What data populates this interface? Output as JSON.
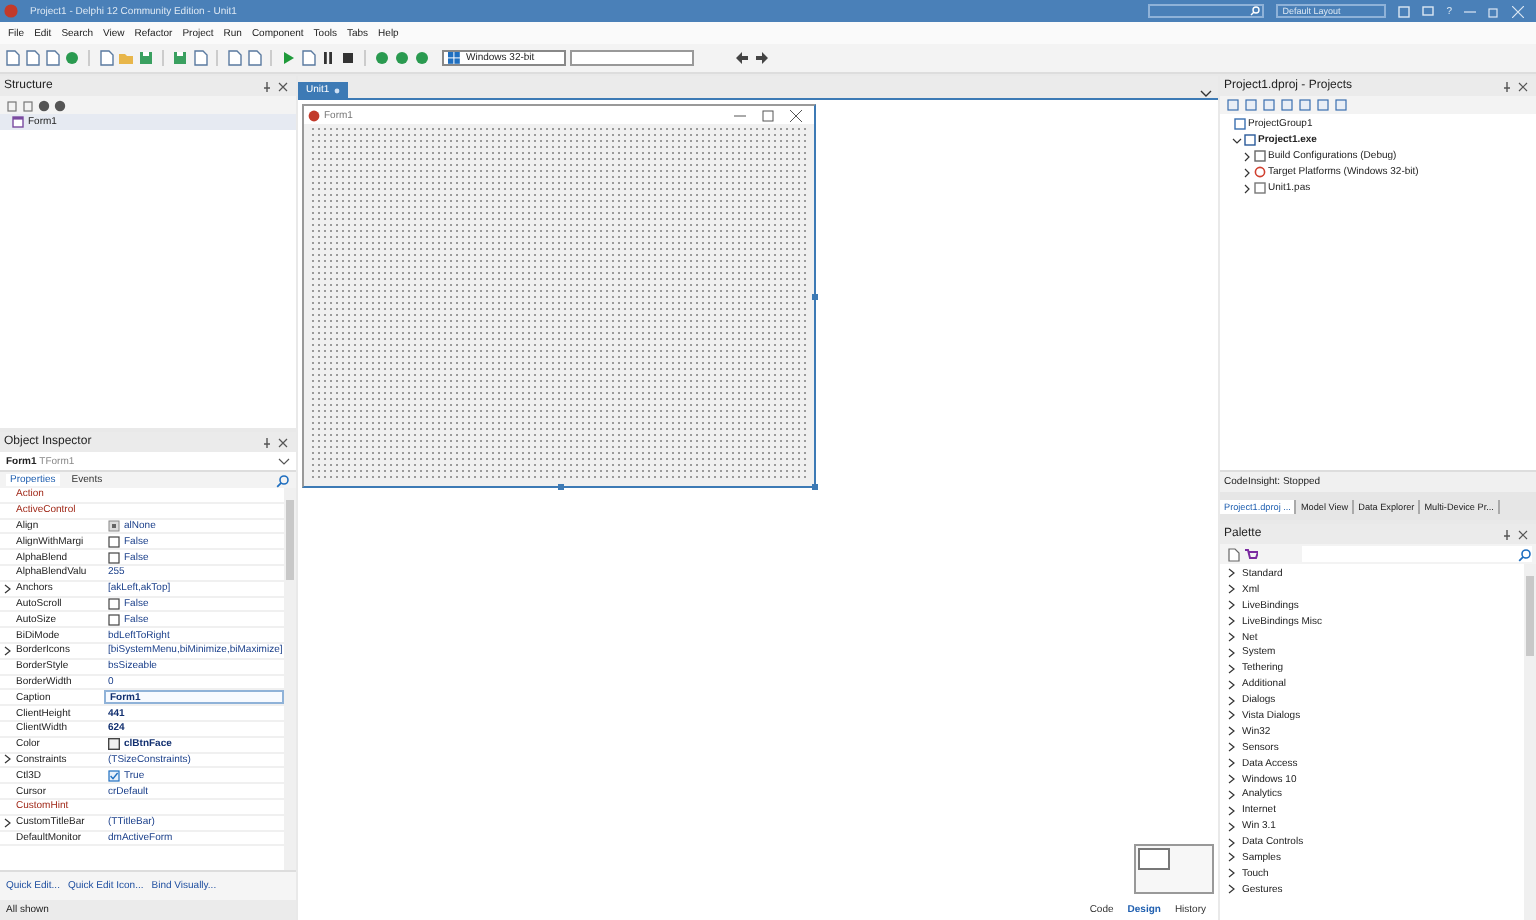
{
  "window": {
    "title": "Project1 - Delphi 12 Community Edition - Unit1",
    "layout": "Default Layout",
    "help": "?"
  },
  "menu": [
    "File",
    "Edit",
    "Search",
    "View",
    "Refactor",
    "Project",
    "Run",
    "Component",
    "Tools",
    "Tabs",
    "Help"
  ],
  "toolbar": {
    "platform": "Windows 32-bit"
  },
  "structure": {
    "title": "Structure",
    "items": [
      {
        "label": "Form1"
      }
    ]
  },
  "editor": {
    "tabs": [
      {
        "label": "Unit1",
        "selected": true
      }
    ],
    "form": {
      "caption": "Form1"
    },
    "view_tabs": [
      {
        "label": "Code",
        "selected": false
      },
      {
        "label": "Design",
        "selected": true
      },
      {
        "label": "History",
        "selected": false
      }
    ]
  },
  "object_inspector": {
    "title": "Object Inspector",
    "object_name": "Form1",
    "object_type": "TForm1",
    "tabs": [
      {
        "label": "Properties",
        "selected": true
      },
      {
        "label": "Events",
        "selected": false
      }
    ],
    "properties": [
      {
        "name": "Action",
        "kind": "ref",
        "expandable": false,
        "selected": false
      },
      {
        "name": "ActiveControl",
        "kind": "ref",
        "expandable": false,
        "selected": false
      },
      {
        "name": "Align",
        "value": "alNone",
        "kind": "align",
        "expandable": false,
        "bold": false,
        "selected": false
      },
      {
        "name": "AlignWithMargi",
        "value": "False",
        "kind": "check",
        "checked": false,
        "expandable": false,
        "bold": false,
        "selected": false
      },
      {
        "name": "AlphaBlend",
        "value": "False",
        "kind": "check",
        "checked": false,
        "expandable": false,
        "bold": false,
        "selected": false
      },
      {
        "name": "AlphaBlendValu",
        "value": "255",
        "kind": "text",
        "expandable": false,
        "bold": false,
        "selected": false
      },
      {
        "name": "Anchors",
        "value": "[akLeft,akTop]",
        "kind": "text",
        "expandable": true,
        "bold": false,
        "selected": false
      },
      {
        "name": "AutoScroll",
        "value": "False",
        "kind": "check",
        "checked": false,
        "expandable": false,
        "bold": false,
        "selected": false
      },
      {
        "name": "AutoSize",
        "value": "False",
        "kind": "check",
        "checked": false,
        "expandable": false,
        "bold": false,
        "selected": false
      },
      {
        "name": "BiDiMode",
        "value": "bdLeftToRight",
        "kind": "text",
        "expandable": false,
        "bold": false,
        "selected": false
      },
      {
        "name": "BorderIcons",
        "value": "[biSystemMenu,biMinimize,biMaximize]",
        "kind": "text",
        "expandable": true,
        "bold": false,
        "selected": false
      },
      {
        "name": "BorderStyle",
        "value": "bsSizeable",
        "kind": "text",
        "expandable": false,
        "bold": false,
        "selected": false
      },
      {
        "name": "BorderWidth",
        "value": "0",
        "kind": "text",
        "expandable": false,
        "bold": false,
        "selected": false
      },
      {
        "name": "Caption",
        "value": "Form1",
        "kind": "text",
        "expandable": false,
        "bold": true,
        "selected": true
      },
      {
        "name": "ClientHeight",
        "value": "441",
        "kind": "text",
        "expandable": false,
        "bold": true,
        "selected": false
      },
      {
        "name": "ClientWidth",
        "value": "624",
        "kind": "text",
        "expandable": false,
        "bold": true,
        "selected": false
      },
      {
        "name": "Color",
        "value": "clBtnFace",
        "kind": "color",
        "color": "#f0f0f0",
        "expandable": false,
        "bold": true,
        "selected": false
      },
      {
        "name": "Constraints",
        "value": "(TSizeConstraints)",
        "kind": "text",
        "expandable": true,
        "bold": false,
        "selected": false
      },
      {
        "name": "Ctl3D",
        "value": "True",
        "kind": "check",
        "checked": true,
        "expandable": false,
        "bold": false,
        "selected": false
      },
      {
        "name": "Cursor",
        "value": "crDefault",
        "kind": "text",
        "expandable": false,
        "bold": false,
        "selected": false
      },
      {
        "name": "CustomHint",
        "kind": "ref",
        "expandable": false,
        "selected": false
      },
      {
        "name": "CustomTitleBar",
        "value": "(TTitleBar)",
        "kind": "text",
        "expandable": true,
        "bold": false,
        "selected": false
      },
      {
        "name": "DefaultMonitor",
        "value": "dmActiveForm",
        "kind": "text",
        "expandable": false,
        "bold": false,
        "selected": false
      }
    ],
    "links": [
      "Quick Edit...",
      "Quick Edit Icon...",
      "Bind Visually..."
    ],
    "status": "All shown"
  },
  "projects": {
    "title": "Project1.dproj - Projects",
    "tree": [
      {
        "label": "ProjectGroup1",
        "kind": "group",
        "children": [
          {
            "label": "Project1.exe",
            "kind": "project",
            "expanded": true,
            "children": [
              {
                "label": "Build Configurations (Debug)",
                "kind": "config",
                "expanded": false
              },
              {
                "label": "Target Platforms (Windows 32-bit)",
                "kind": "platform",
                "expanded": false
              },
              {
                "label": "Unit1.pas",
                "kind": "file",
                "expanded": false
              }
            ]
          }
        ]
      }
    ],
    "status": "CodeInsight: Stopped",
    "tabs": [
      {
        "label": "Project1.dproj ...",
        "selected": true
      },
      {
        "label": "Model View",
        "selected": false
      },
      {
        "label": "Data Explorer",
        "selected": false
      },
      {
        "label": "Multi-Device Pr...",
        "selected": false
      }
    ]
  },
  "palette": {
    "title": "Palette",
    "categories": [
      "Standard",
      "Xml",
      "LiveBindings",
      "LiveBindings Misc",
      "Net",
      "System",
      "Tethering",
      "Additional",
      "Dialogs",
      "Vista Dialogs",
      "Win32",
      "Sensors",
      "Data Access",
      "Windows 10",
      "Analytics",
      "Internet",
      "Win 3.1",
      "Data Controls",
      "Samples",
      "Touch",
      "Gestures"
    ]
  }
}
